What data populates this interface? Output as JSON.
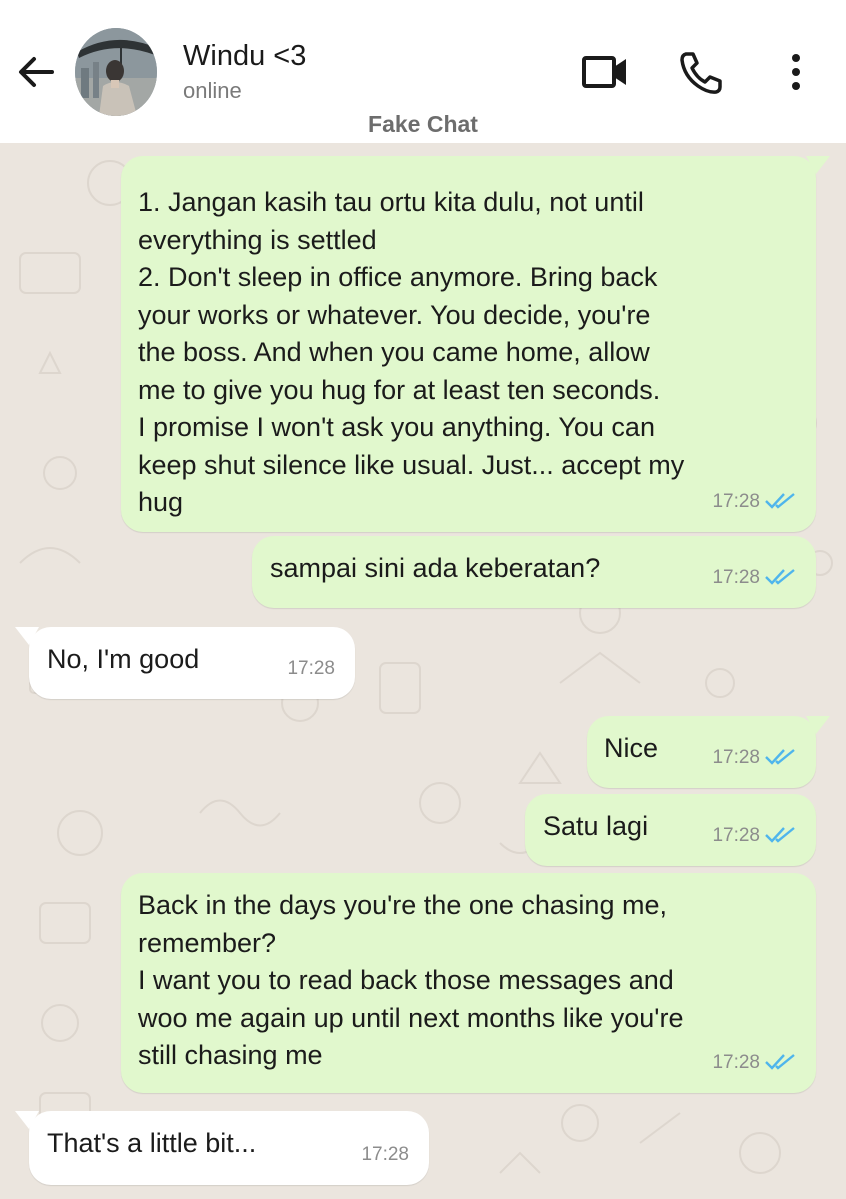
{
  "header": {
    "contact_name": "Windu <3",
    "status": "online",
    "watermark": "Fake Chat",
    "icons": {
      "back": "arrow-left-icon",
      "video": "video-call-icon",
      "call": "phone-icon",
      "more": "more-vertical-icon"
    }
  },
  "colors": {
    "outgoing_bubble": "#e1f8cd",
    "incoming_bubble": "#ffffff",
    "chat_background": "#ebe5de",
    "read_ticks": "#4fb5ec"
  },
  "messages": [
    {
      "direction": "out",
      "text": "1. Jangan kasih tau ortu kita dulu, not until\neverything is settled\n2. Don't sleep in office anymore. Bring back\nyour works or whatever. You decide, you're\nthe boss. And when you came home, allow\nme to give you hug for at least ten seconds.\nI promise I won't ask you anything. You can\nkeep shut silence like usual. Just... accept my\nhug",
      "time": "17:28",
      "read": true
    },
    {
      "direction": "out",
      "text": "sampai sini ada keberatan?",
      "time": "17:28",
      "read": true
    },
    {
      "direction": "in",
      "text": "No, I'm good",
      "time": "17:28"
    },
    {
      "direction": "out",
      "text": "Nice",
      "time": "17:28",
      "read": true
    },
    {
      "direction": "out",
      "text": "Satu lagi",
      "time": "17:28",
      "read": true
    },
    {
      "direction": "out",
      "text": "Back in the days you're the one chasing me,\nremember?\nI want you to read back those messages and\nwoo me again up until next months like you're\nstill chasing me",
      "time": "17:28",
      "read": true
    },
    {
      "direction": "in",
      "text": "That's a little bit...",
      "time": "17:28"
    }
  ]
}
